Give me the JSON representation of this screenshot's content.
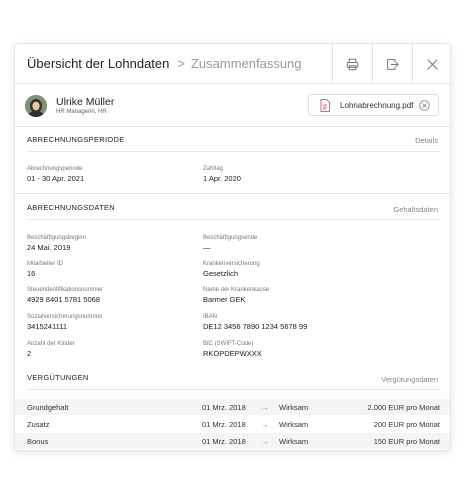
{
  "header": {
    "title": "Übersicht der Lohndaten",
    "separator": ">",
    "crumb": "Zusammenfassung",
    "actions": [
      {
        "name": "print-button",
        "icon": "printer-icon"
      },
      {
        "name": "export-button",
        "icon": "export-icon"
      },
      {
        "name": "close-button",
        "icon": "close-icon"
      }
    ]
  },
  "profile": {
    "name": "Ulrike Müller",
    "role": "HR Managerin, HR"
  },
  "attachment": {
    "filename": "Lohnabrechnung.pdf",
    "icon": "pdf-file-icon",
    "remove_icon": "remove-circle-icon"
  },
  "abrechnungsperiode": {
    "title": "ABRECHNUNGSPERIODE",
    "link": "Details",
    "fields": {
      "periode_label": "Abrechnungsperiode",
      "periode_value": "01 - 30 Apr. 2021",
      "zahltag_label": "Zahltag",
      "zahltag_value": "1 Apr. 2020"
    }
  },
  "abrechnungsdaten": {
    "title": "ABRECHNUNGSDATEN",
    "link": "Gehaltsdaten",
    "fields": {
      "beginn_label": "Beschäftigungsbeginn",
      "beginn_value": "24 Mai. 2019",
      "ende_label": "Beschäftigungsende",
      "ende_value": "—",
      "mitarbeiter_label": "Mitarbeiter ID",
      "mitarbeiter_value": "16",
      "kv_label": "Krankenversicherung",
      "kv_value": "Gesetzlich",
      "steuer_label": "Steueridentifikationsnummer",
      "steuer_value": "4929 8401 5781 5068",
      "kasse_label": "Name der Krankenkasse",
      "kasse_value": "Barmer GEK",
      "sozial_label": "Sozialversicherungsnummer",
      "sozial_value": "3415241111",
      "iban_label": "IBAN",
      "iban_value": "DE12 3456 7890 1234 5678 99",
      "kinder_label": "Anzahl der Kinder",
      "kinder_value": "2",
      "bic_label": "BIC (SWIFT-Code)",
      "bic_value": "RKOPDEPWXXX"
    }
  },
  "verguetungen": {
    "title": "VERGÜTUNGEN",
    "link": "Vergütungsdaten",
    "rows": [
      {
        "name": "Grundgehalt",
        "date": "01 Mrz. 2018",
        "arrow": "→",
        "status": "Wirksam",
        "amount": "2.000 EUR pro Monat"
      },
      {
        "name": "Zusatz",
        "date": "01 Mrz. 2018",
        "arrow": "→",
        "status": "Wirksam",
        "amount": "200 EUR pro Monat"
      },
      {
        "name": "Bonus",
        "date": "01 Mrz. 2018",
        "arrow": "→",
        "status": "Wirksam",
        "amount": "150 EUR pro Monat"
      }
    ]
  },
  "colors": {
    "text": "#222222",
    "muted": "#888888",
    "border": "#e6e6e6",
    "row_alt": "#f4f4f4",
    "pdf_accent": "#e0607e"
  }
}
